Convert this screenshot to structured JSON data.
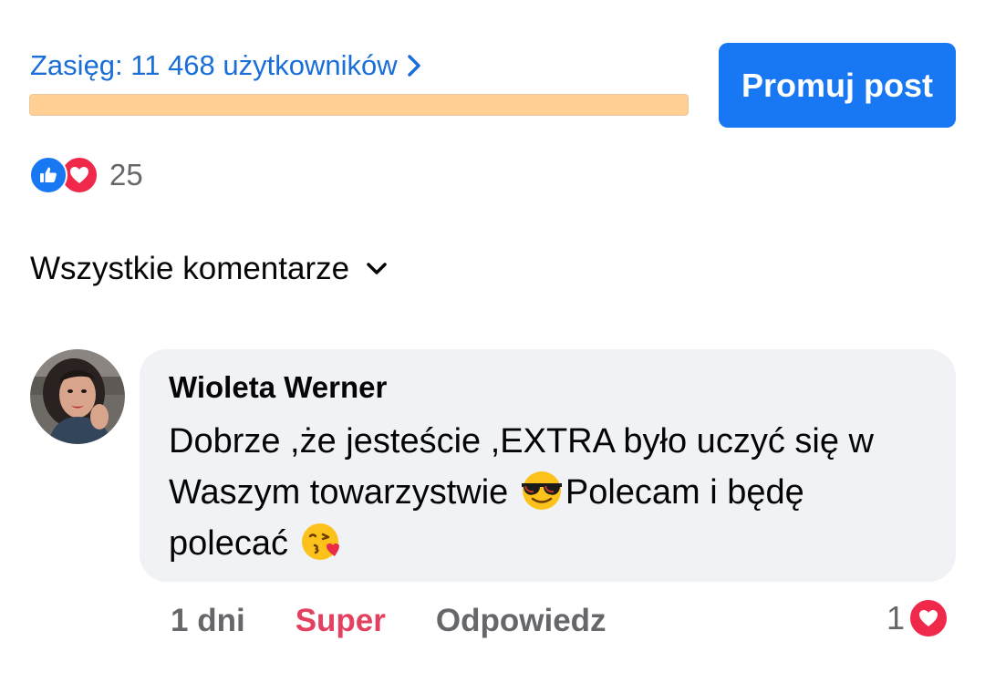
{
  "reach": {
    "label": "Zasięg: 11 468 użytkowników",
    "bar_color": "#ffcf94"
  },
  "promote": {
    "label": "Promuj post",
    "color": "#1877f2"
  },
  "post_reactions": {
    "icons": [
      "like-icon",
      "love-icon"
    ],
    "count": "25"
  },
  "comments_filter": {
    "label": "Wszystkie komentarze"
  },
  "comment": {
    "author": "Wioleta Werner",
    "text_part1": "Dobrze ,że jesteście ,EXTRA było uczyć się w Waszym towarzystwie ",
    "emoji1": "smiling-face-with-sunglasses",
    "text_part2": "Polecam i będę polecać ",
    "emoji2": "face-blowing-a-kiss",
    "time": "1 dni",
    "like_label": "Super",
    "reply_label": "Odpowiedz",
    "reaction_count": "1",
    "reaction_icon": "love-icon",
    "like_color": "#e4405f"
  }
}
